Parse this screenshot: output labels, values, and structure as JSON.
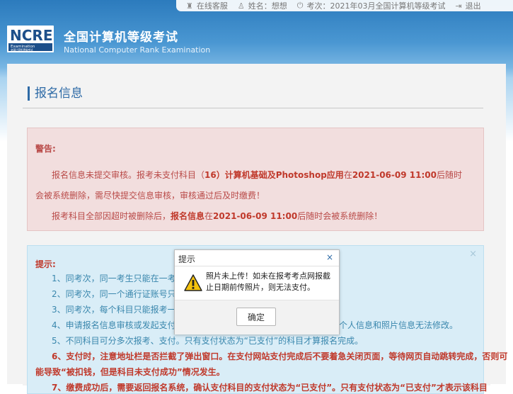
{
  "topbar": {
    "service": {
      "icon": "headset-icon",
      "label": "在线客服"
    },
    "user": {
      "icon": "user-icon",
      "label": "姓名：想想"
    },
    "exam": {
      "icon": "power-icon",
      "label": "考次：2021年03月全国计算机等级考试"
    },
    "logout": {
      "icon": "logout-icon",
      "label": "退出"
    }
  },
  "header": {
    "logo_text": "NCRE",
    "logo_caption": "Examination",
    "logo_subcaption": "全国计算机等级考试",
    "title_cn": "全国计算机等级考试",
    "title_en": "National Computer Rank Examination"
  },
  "section": {
    "title": "报名信息"
  },
  "warning": {
    "title": "警告:",
    "line1": {
      "a": "报名信息未提交审核。报考未支付科目（",
      "b": "16）计算机基础及Photoshop应用",
      "c": "在",
      "d": "2021-06-09 11:00",
      "e": "后随时"
    },
    "line2": "会被系统删除，需尽快提交信息审核，审核通过后及时缴费！",
    "line3": {
      "a": "报考科目全部因超时被删除后，",
      "b": "报名信息",
      "c": "在",
      "d": "2021-06-09 11:00",
      "e": "后随时会被系统删除！"
    }
  },
  "tips": {
    "title": "提示:",
    "close": "×",
    "l1": "1、同考次，同一考生只能在一考点报",
    "l2": "2、同考次，同一个通行证账号只能",
    "l3": "3、同考次，每个科目只能报考一次。",
    "l4a": "4、申请报名信息审核或发起支付，",
    "l4b": "个人信息和照片信息无法修改。",
    "l5": "5、不同科目可分多次报考、支付。只有支付状态为“已支付”的科目才算报名完成。",
    "l6a": "6、支付时，注意地址栏是否拦截了弹出窗口。在支付网站支付完成后不要着急关闭页面，等待网页自动跳转完成，否则可",
    "l6b": "能导致“被扣钱，但是科目未支付成功”情况发生。",
    "l7": "7、缴费成功后，需要返回报名系统，确认支付科目的支付状态为“已支付”。只有支付状态为“已支付”才表示该科目"
  },
  "modal": {
    "title": "提示",
    "close": "×",
    "icon": "warning-icon",
    "message": "照片未上传！如未在报考考点网报截止日期前传照片，则无法支付。",
    "ok": "确定"
  }
}
